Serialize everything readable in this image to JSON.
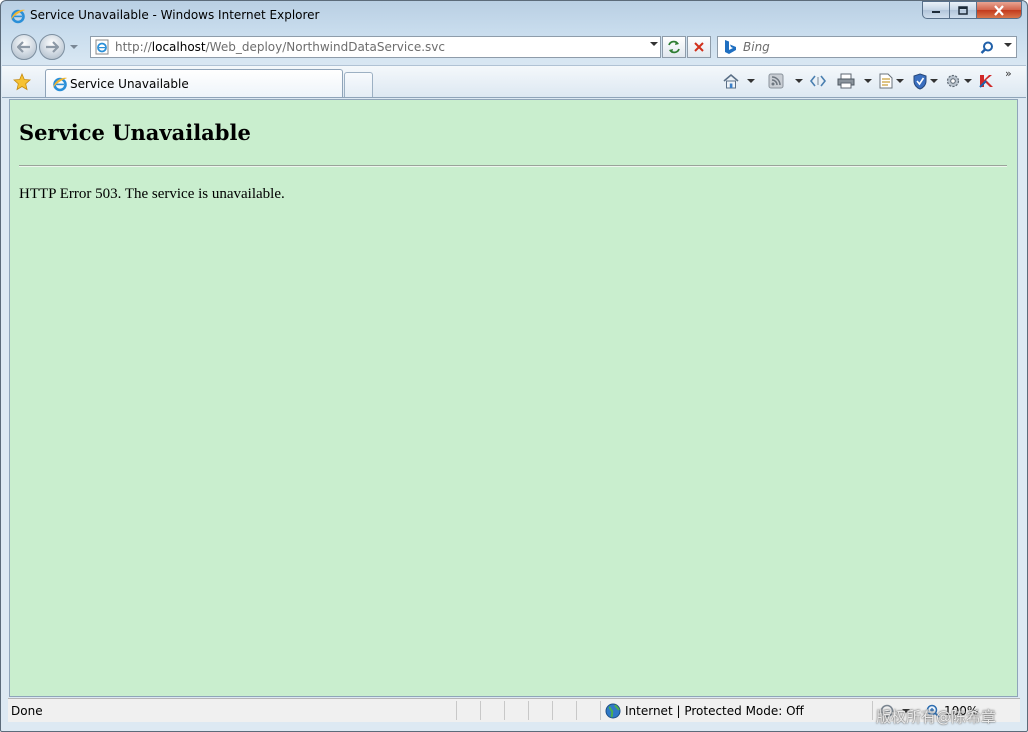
{
  "window": {
    "title": "Service Unavailable - Windows Internet Explorer"
  },
  "address_bar": {
    "prefix": "http://",
    "host": "localhost",
    "path": "/Web_deploy/NorthwindDataService.svc"
  },
  "search": {
    "placeholder": "Bing"
  },
  "tabs": [
    {
      "label": "Service Unavailable"
    }
  ],
  "page": {
    "title": "Service Unavailable",
    "message": "HTTP Error 503. The service is unavailable.",
    "background": "#c9eece"
  },
  "status_bar": {
    "status": "Done",
    "zone": "Internet | Protected Mode: Off",
    "zoom": "100%"
  },
  "watermark": "版权所有@陈希章",
  "colors": {
    "close_button": "#c2391c",
    "frame": "#c8dced"
  }
}
